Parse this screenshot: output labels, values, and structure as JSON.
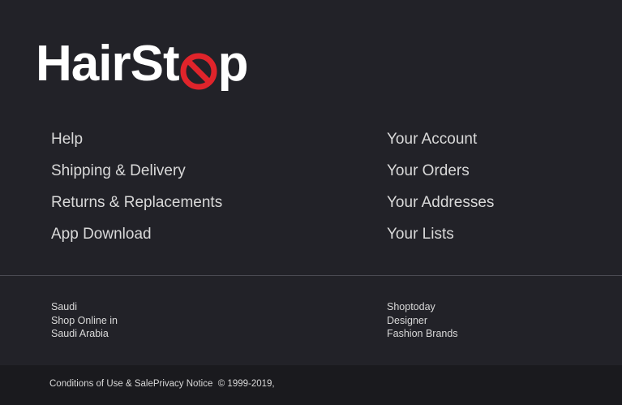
{
  "brand": {
    "logo_part1": "HairSt",
    "logo_part2": "p",
    "no_sign_color": "#e0242b"
  },
  "links": {
    "left": [
      "Help",
      "Shipping & Delivery",
      "Returns & Replacements",
      "App Download"
    ],
    "right": [
      "Your Account",
      "Your Orders",
      "Your Addresses",
      "Your Lists"
    ]
  },
  "regions": {
    "left": [
      "Saudi",
      "Shop Online in",
      "Saudi Arabia"
    ],
    "right": [
      "Shoptoday",
      "Designer",
      "Fashion Brands"
    ]
  },
  "footer": {
    "conditions": "Conditions of Use & Sale",
    "privacy": "Privacy Notice",
    "copyright": "© 1999-2019,"
  }
}
